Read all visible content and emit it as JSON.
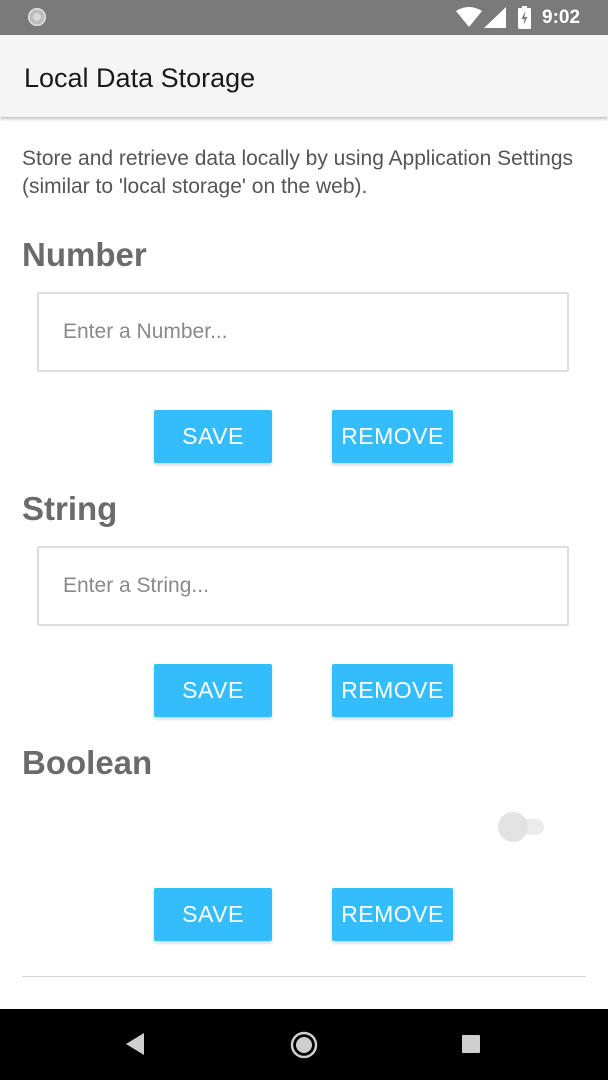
{
  "status_bar": {
    "time": "9:02"
  },
  "app_bar": {
    "title": "Local Data Storage"
  },
  "intro": "Store and retrieve data locally by using Application Settings (similar to 'local storage' on the web).",
  "number": {
    "title": "Number",
    "placeholder": "Enter a Number...",
    "value": "",
    "save_label": "SAVE",
    "remove_label": "REMOVE"
  },
  "string": {
    "title": "String",
    "placeholder": "Enter a String...",
    "value": "",
    "save_label": "SAVE",
    "remove_label": "REMOVE"
  },
  "boolean": {
    "title": "Boolean",
    "switch_on": false,
    "save_label": "SAVE",
    "remove_label": "REMOVE"
  },
  "colors": {
    "accent": "#33bdfc",
    "status_bar": "#7a7a7a",
    "app_bar": "#f5f5f5",
    "section_title": "#6b6b6b"
  },
  "icons": {
    "status": [
      "notification-dot-icon",
      "wifi-icon",
      "signal-icon",
      "battery-charging-icon"
    ],
    "nav": [
      "back-icon",
      "home-icon",
      "recents-icon"
    ]
  }
}
